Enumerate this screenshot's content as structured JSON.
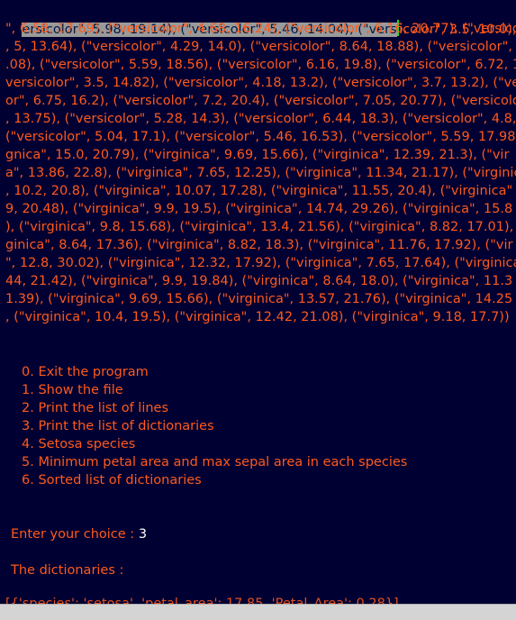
{
  "output_lines": [
    "\", 6.58, 17.69), (\"versicolor\", 4.68, 16.24), (\"versicolor\", 6.16, 20.77), (\"versicolo",
    ", 5, 13.64), (\"versicolor\", 4.29, 14.0), (\"versicolor\", 8.64, 18.88), (\"versicolor\", 5.2",
    ".08), (\"versicolor\", 5.59, 18.56), (\"versicolor\", 6.16, 19.8), (\"versicolor\", 6.72, 19",
    "versicolor\", 3.5, 14.82), (\"versicolor\", 4.18, 13.2), (\"versicolor\", 3.7, 13.2), (\"ve",
    "or\", 6.75, 16.2), (\"versicolor\", 7.2, 20.4), (\"versicolor\", 7.05, 20.77), (\"versicolo",
    ", 13.75), (\"versicolor\", 5.28, 14.3), (\"versicolor\", 6.44, 18.3), (\"versicolor\", 4.8,",
    "(\"versicolor\", 5.04, 17.1), (\"versicolor\", 5.46, 16.53), (\"versicolor\", 5.59, 17.98)",
    "gnica\", 15.0, 20.79), (\"virginica\", 9.69, 15.66), (\"virginica\", 12.39, 21.3), (\"vir",
    "a\", 13.86, 22.8), (\"virginica\", 7.65, 12.25), (\"virginica\", 11.34, 21.17), (\"virginic",
    ", 10.2, 20.8), (\"virginica\", 10.07, 17.28), (\"virginica\", 11.55, 20.4), (\"virginica\"",
    "9, 20.48), (\"virginica\", 9.9, 19.5), (\"virginica\", 14.74, 29.26), (\"virginica\", 15.8",
    "), (\"virginica\", 9.8, 15.68), (\"virginica\", 13.4, 21.56), (\"virginica\", 8.82, 17.01),",
    "ginica\", 8.64, 17.36), (\"virginica\", 8.82, 18.3), (\"virginica\", 11.76, 17.92), (\"vir",
    "\", 12.8, 30.02), (\"virginica\", 12.32, 17.92), (\"virginica\", 7.65, 17.64), (\"virginica",
    "44, 21.42), (\"virginica\", 9.9, 19.84), (\"virginica\", 8.64, 18.0), (\"virginica\", 11.3",
    "1.39), (\"virginica\", 9.69, 15.66), (\"virginica\", 13.57, 21.76), (\"virginica\", 14.25",
    ", (\"virginica\", 10.4, 19.5), (\"virginica\", 12.42, 21.08), (\"virginica\", 9.18, 17.7))"
  ],
  "first_line": {
    "selected": "ersicolor\", 5.98, 19.14), (\"versicolor\", 5.46, 14.04), (\"vers",
    "after_cursor": "icolor\", 3.5, 10.0), (\"ve"
  },
  "menu": [
    "0. Exit the program",
    "1. Show the file",
    "2. Print the list of lines",
    "3. Print the list of dictionaries",
    "4. Setosa species",
    "5. Minimum petal area and max sepal area in each species",
    "6. Sorted list of dictionaries"
  ],
  "prompt": {
    "label": "Enter your choice : ",
    "value": "3"
  },
  "dictionaries_heading": "The dictionaries :",
  "partial_line": "[{'species': 'setosa', 'petal_area': 17.85, 'Petal_Area': 0.28}]",
  "colors": {
    "background": "#000033",
    "text": "#ff5a1a",
    "input": "#ffffff",
    "selection": "#9a9a9a",
    "cursor": "#22dd22"
  }
}
